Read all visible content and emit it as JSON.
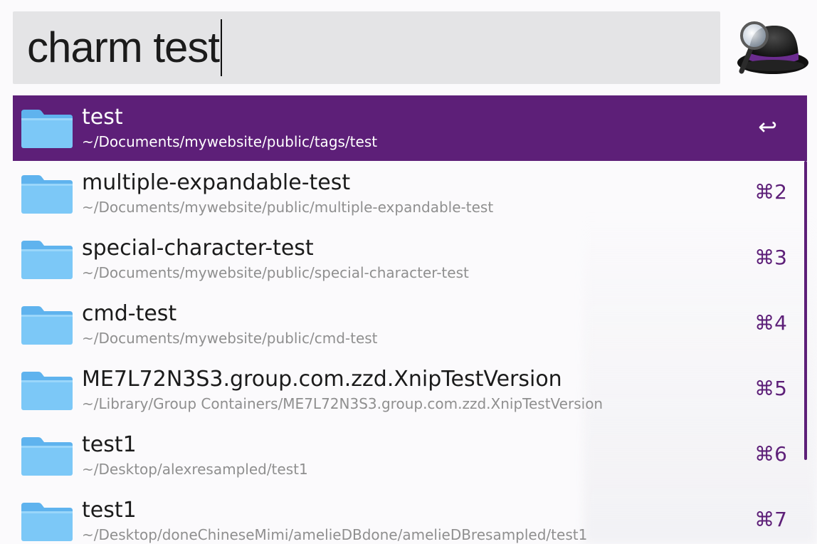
{
  "search": {
    "query": "charm test"
  },
  "app_icon": {
    "name": "alfred-hat-icon"
  },
  "colors": {
    "accent": "#5d1f78",
    "search_bg": "#e4e4e6",
    "folder_light": "#7cc8f7",
    "folder_dark": "#5fb3ee"
  },
  "results": [
    {
      "title": "test",
      "path": "~/Documents/mywebsite/public/tags/test",
      "shortcut": "↩",
      "selected": true
    },
    {
      "title": "multiple-expandable-test",
      "path": "~/Documents/mywebsite/public/multiple-expandable-test",
      "shortcut": "⌘2",
      "selected": false
    },
    {
      "title": "special-character-test",
      "path": "~/Documents/mywebsite/public/special-character-test",
      "shortcut": "⌘3",
      "selected": false
    },
    {
      "title": "cmd-test",
      "path": "~/Documents/mywebsite/public/cmd-test",
      "shortcut": "⌘4",
      "selected": false
    },
    {
      "title": "ME7L72N3S3.group.com.zzd.XnipTestVersion",
      "path": "~/Library/Group Containers/ME7L72N3S3.group.com.zzd.XnipTestVersion",
      "shortcut": "⌘5",
      "selected": false
    },
    {
      "title": "test1",
      "path": "~/Desktop/alexresampled/test1",
      "shortcut": "⌘6",
      "selected": false
    },
    {
      "title": "test1",
      "path": "~/Desktop/doneChineseMimi/amelieDBdone/amelieDBresampled/test1",
      "shortcut": "⌘7",
      "selected": false
    }
  ]
}
